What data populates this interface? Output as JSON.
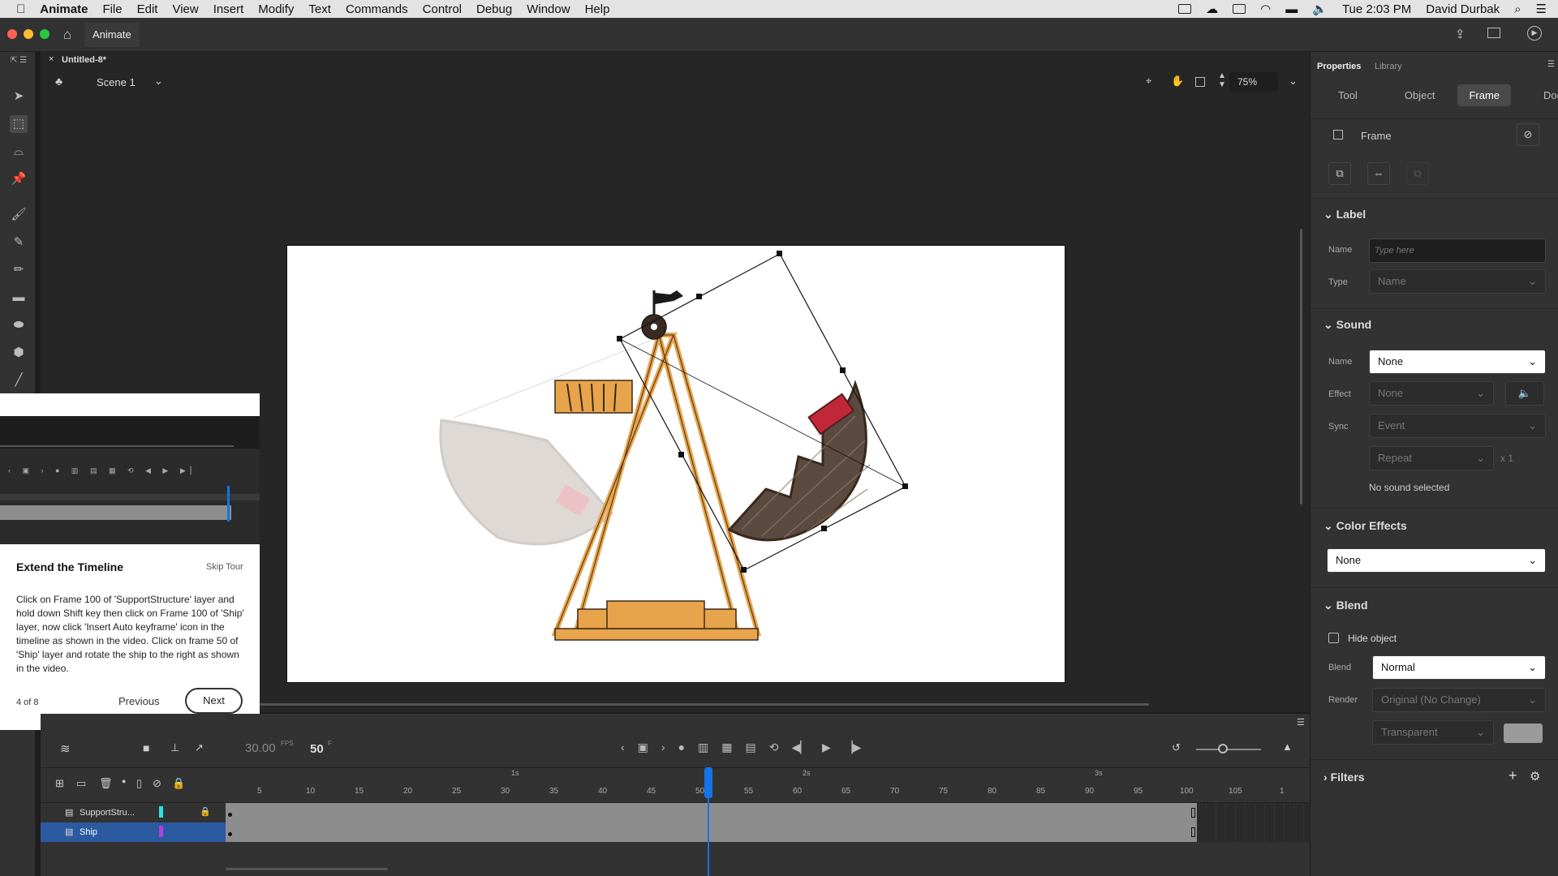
{
  "menubar": {
    "apple": "",
    "app": "Animate",
    "items": [
      "File",
      "Edit",
      "View",
      "Insert",
      "Modify",
      "Text",
      "Commands",
      "Control",
      "Debug",
      "Window",
      "Help"
    ],
    "clock": "Tue 2:03 PM",
    "user": "David Durbak"
  },
  "window": {
    "app_label": "Animate",
    "document_tab": "Untitled-8*",
    "scene": "Scene 1",
    "zoom": "75%"
  },
  "tour": {
    "title": "Extend the Timeline",
    "skip": "Skip Tour",
    "body": "Click on Frame 100 of 'SupportStructure' layer and hold down Shift key then click on Frame 100 of 'Ship' layer, now click 'Insert Auto keyframe' icon in the timeline as shown in the video. Click on frame 50 of 'Ship' layer and rotate the ship to the right as shown in the video.",
    "step": "4 of 8",
    "previous": "Previous",
    "next": "Next"
  },
  "timeline": {
    "fps": "30.00",
    "fps_unit": "FPS",
    "frame": "50",
    "frame_unit": "F",
    "seconds": [
      "1s",
      "2s",
      "3s"
    ],
    "ruler": [
      "5",
      "10",
      "15",
      "20",
      "25",
      "30",
      "35",
      "40",
      "45",
      "50",
      "55",
      "60",
      "65",
      "70",
      "75",
      "80",
      "85",
      "90",
      "95",
      "100",
      "105",
      "1"
    ],
    "layers": [
      {
        "name": "SupportStru...",
        "color": "#2fe0e0",
        "locked": true
      },
      {
        "name": "Ship",
        "color": "#b040e0",
        "locked": false
      }
    ],
    "current_frame": 50,
    "total_frames": 100
  },
  "properties": {
    "tabs": [
      "Properties",
      "Library"
    ],
    "subtabs": [
      "Tool",
      "Object",
      "Frame",
      "Doc"
    ],
    "active_subtab": "Frame",
    "section_title": "Frame",
    "label": {
      "title": "Label",
      "name_label": "Name",
      "name_placeholder": "Type here",
      "type_label": "Type",
      "type_value": "Name"
    },
    "sound": {
      "title": "Sound",
      "name_label": "Name",
      "name_value": "None",
      "effect_label": "Effect",
      "effect_value": "None",
      "sync_label": "Sync",
      "sync_value": "Event",
      "repeat_value": "Repeat",
      "repeat_count": "x 1",
      "status": "No sound selected"
    },
    "color_effects": {
      "title": "Color Effects",
      "value": "None"
    },
    "blend": {
      "title": "Blend",
      "hide_object": "Hide object",
      "blend_label": "Blend",
      "blend_value": "Normal",
      "render_label": "Render",
      "render_value": "Original (No Change)",
      "transparent_value": "Transparent"
    },
    "filters": {
      "title": "Filters"
    }
  },
  "colors": {
    "accent": "#1473e6",
    "ship_dark": "#5a4a40",
    "ship_red": "#c0283a",
    "structure": "#e8a44a"
  }
}
